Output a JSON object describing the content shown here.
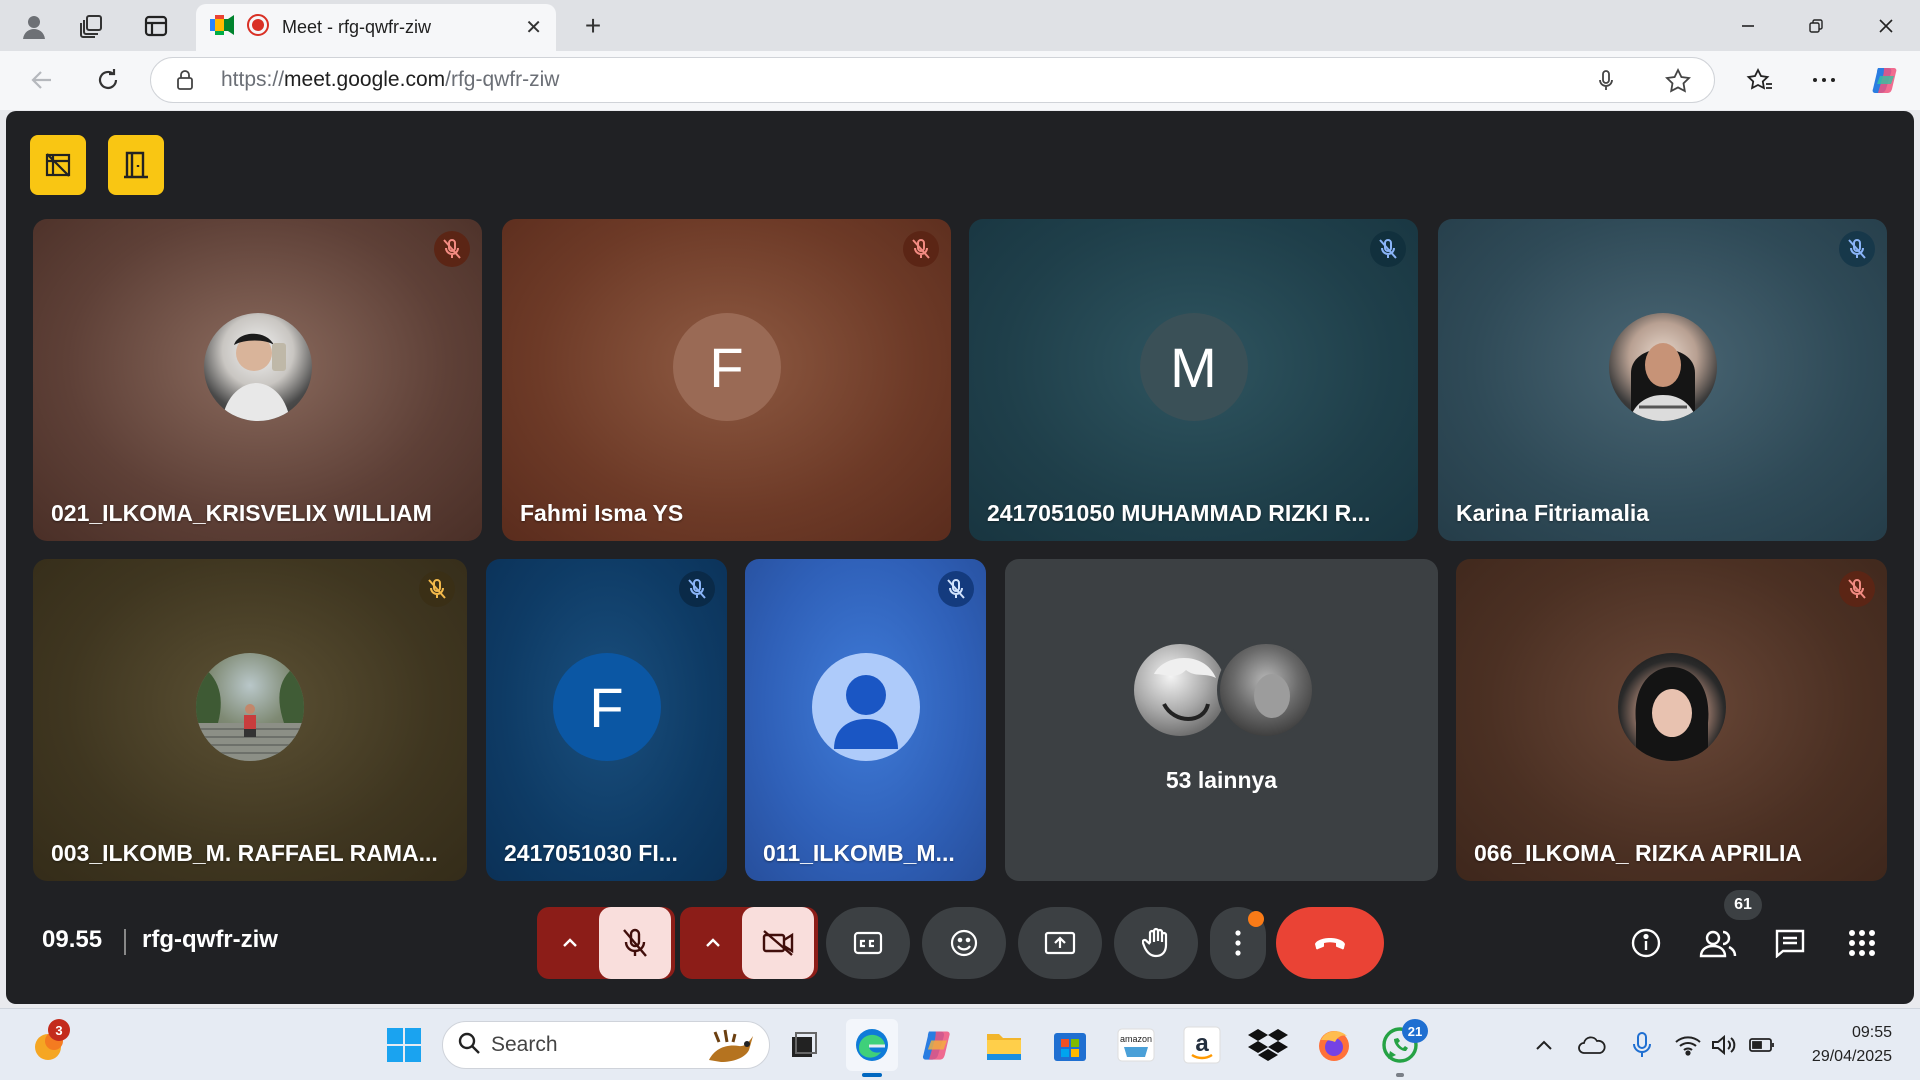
{
  "browser": {
    "tab_title": "Meet - rfg-qwfr-ziw",
    "url_scheme": "https://",
    "url_host": "meet.google.com",
    "url_path": "/rfg-qwfr-ziw"
  },
  "participants": [
    {
      "name": "021_ILKOMA_KRISVELIX WILLIAM",
      "avatar": "photo",
      "muted": true
    },
    {
      "name": "Fahmi Isma YS",
      "avatar_letter": "F",
      "muted": true
    },
    {
      "name": "2417051050 MUHAMMAD RIZKI R...",
      "avatar_letter": "M",
      "muted": true
    },
    {
      "name": "Karina Fitriamalia",
      "avatar": "photo",
      "muted": true
    },
    {
      "name": "003_ILKOMB_M. RAFFAEL RAMA...",
      "avatar": "photo",
      "muted": true
    },
    {
      "name": "2417051030 FI...",
      "avatar_letter": "F",
      "muted": true
    },
    {
      "name": "011_ILKOMB_M...",
      "avatar": "person-icon",
      "muted": true
    },
    {
      "name": "53 lainnya",
      "avatar": "group"
    },
    {
      "name": "066_ILKOMA_ RIZKA APRILIA",
      "avatar": "photo",
      "muted": true
    }
  ],
  "meeting": {
    "time": "09.55",
    "code": "rfg-qwfr-ziw",
    "people_count": "61"
  },
  "taskbar": {
    "search_placeholder": "Search",
    "notif_badge": "3",
    "whatsapp_badge": "21",
    "clock_time": "09:55",
    "clock_date": "29/04/2025"
  },
  "colors": {
    "stage_bg": "#202124",
    "hangup": "#ea4335",
    "mic_off_bg": "#f9dedc",
    "yellow_button": "#f9c613"
  }
}
